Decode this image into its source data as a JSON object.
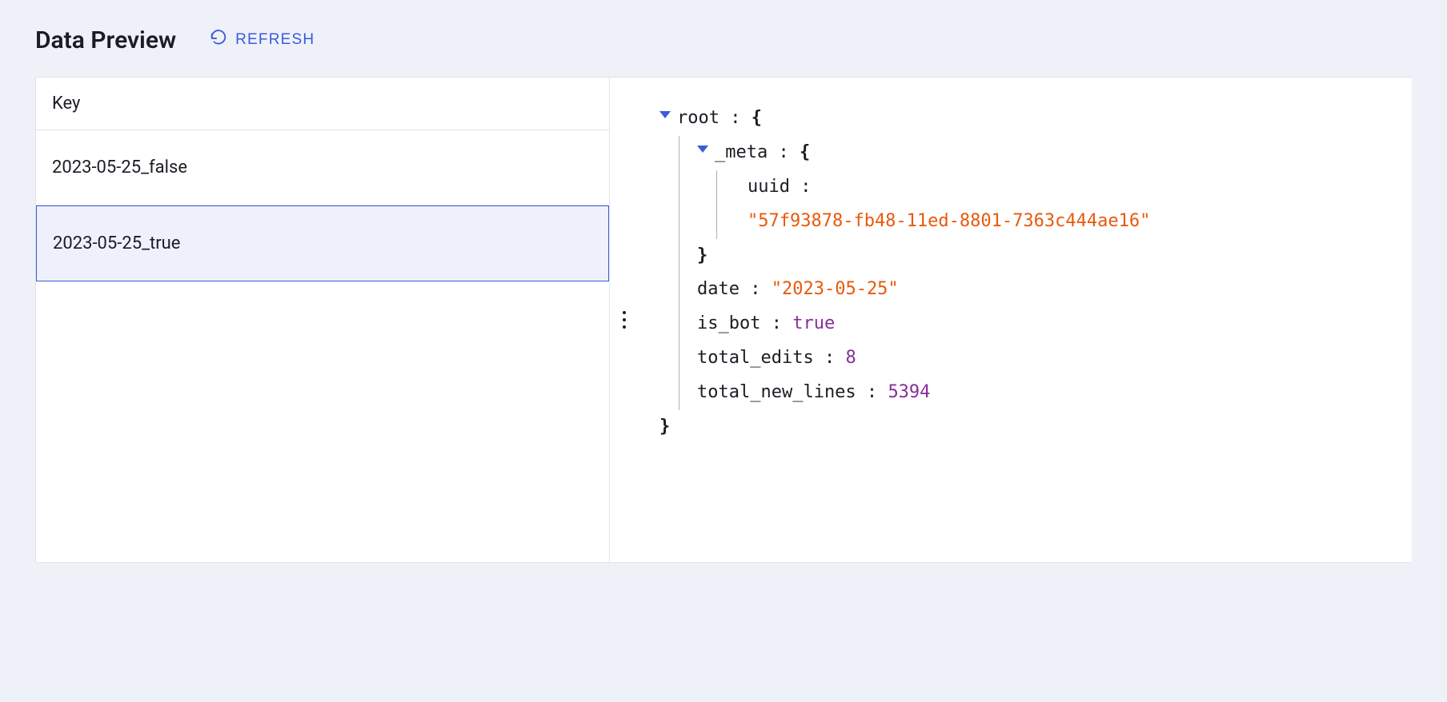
{
  "title": "Data Preview",
  "refresh_label": "REFRESH",
  "table": {
    "header": "Key",
    "rows": [
      {
        "key": "2023-05-25_false",
        "selected": false
      },
      {
        "key": "2023-05-25_true",
        "selected": true
      }
    ]
  },
  "tree": {
    "root_label": "root",
    "open_brace": "{",
    "close_brace": "}",
    "meta": {
      "label": "_meta",
      "uuid_key": "uuid",
      "uuid_value": "\"57f93878-fb48-11ed-8801-7363c444ae16\""
    },
    "date_key": "date",
    "date_value": "\"2023-05-25\"",
    "is_bot_key": "is_bot",
    "is_bot_value": "true",
    "total_edits_key": "total_edits",
    "total_edits_value": "8",
    "total_new_lines_key": "total_new_lines",
    "total_new_lines_value": "5394",
    "colon": " : "
  }
}
